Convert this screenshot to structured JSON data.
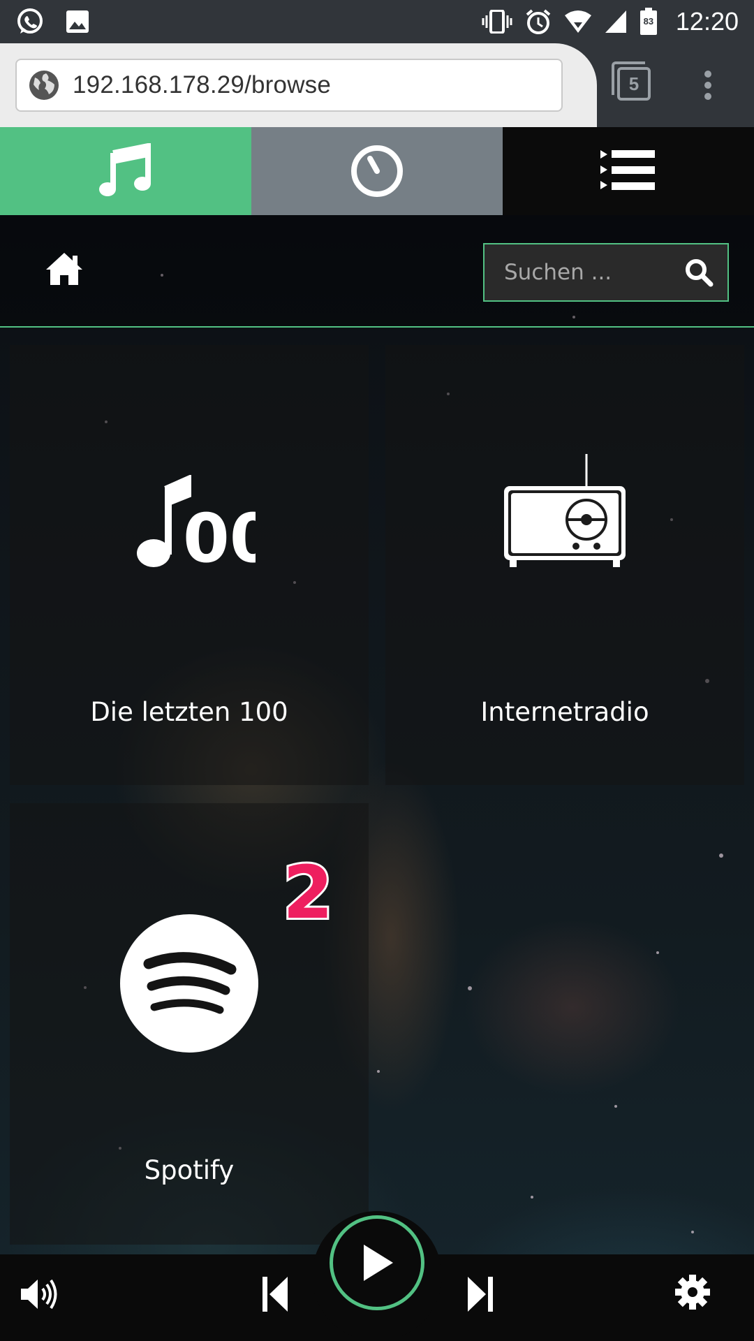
{
  "status_bar": {
    "time": "12:20",
    "battery": "83",
    "icons": [
      "whatsapp-icon",
      "image-icon",
      "vibrate-icon",
      "alarm-icon",
      "wifi-icon",
      "signal-icon",
      "battery-icon"
    ]
  },
  "browser": {
    "url": "192.168.178.29/browse",
    "tab_count": "5"
  },
  "mode_tabs": [
    {
      "name": "browse",
      "icon": "music-note-icon",
      "color": "#52c183",
      "active": true
    },
    {
      "name": "queue",
      "icon": "clock-icon",
      "color": "#767f86"
    },
    {
      "name": "playlist",
      "icon": "list-icon",
      "color": "#0b0b0b"
    }
  ],
  "header": {
    "search_placeholder": "Suchen ..."
  },
  "tiles": [
    {
      "label": "Die letzten 100",
      "icon": "music-100-icon"
    },
    {
      "label": "Internetradio",
      "icon": "radio-icon"
    },
    {
      "label": "Spotify",
      "icon": "spotify-icon",
      "badge": "2"
    }
  ],
  "player": {
    "controls": [
      "volume-icon",
      "previous-icon",
      "play-icon",
      "next-icon",
      "settings-icon"
    ],
    "accent": "#52c183"
  }
}
